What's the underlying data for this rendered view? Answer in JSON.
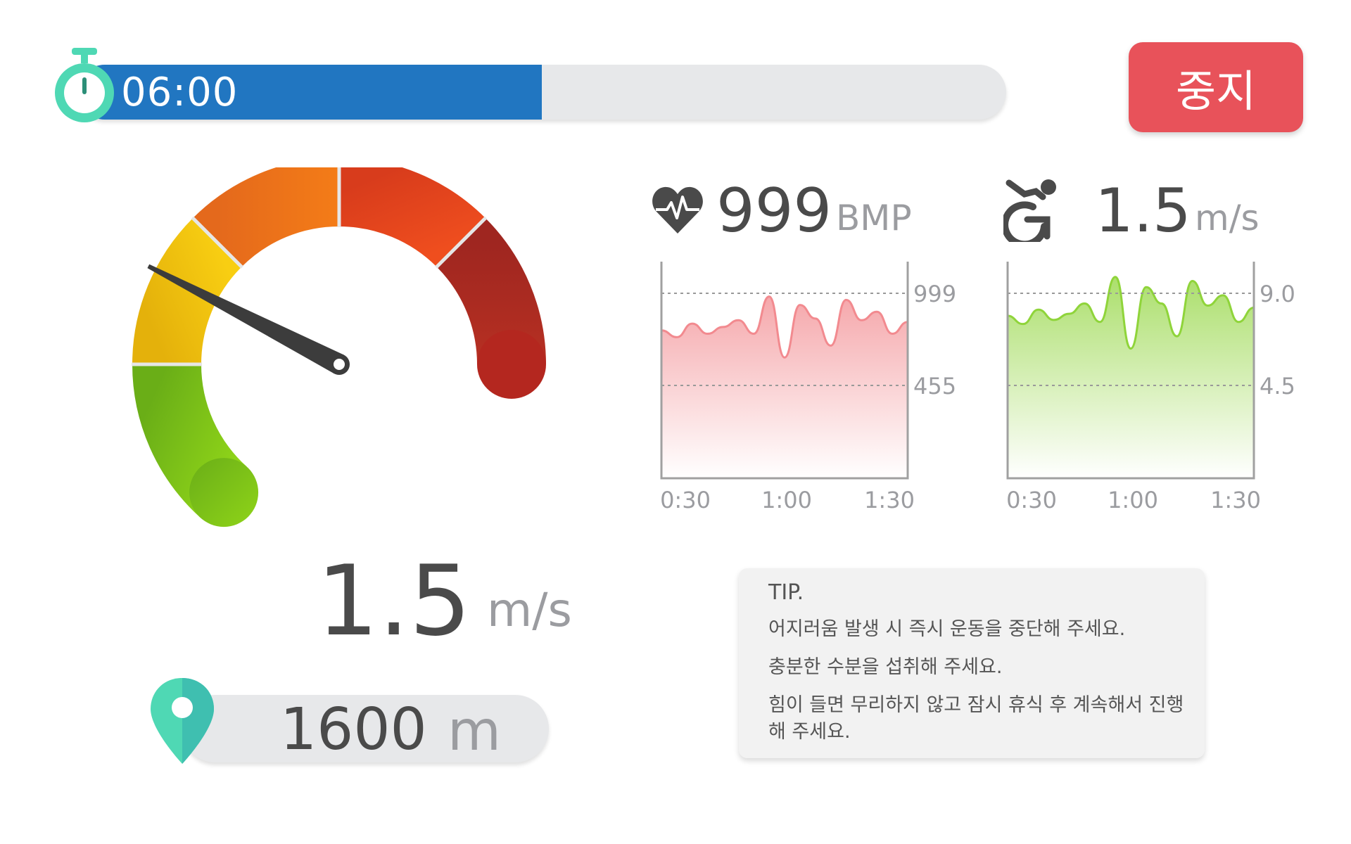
{
  "timer": {
    "label": "06:00",
    "progress": 0.5,
    "color": "#2176c1"
  },
  "stop_button": {
    "label": "중지",
    "color": "#e8525a"
  },
  "gauge": {
    "value": 1.5,
    "value_text": "1.5",
    "unit": "m/s",
    "needle_level": 0.33,
    "segment_colors": [
      "#7cc11a",
      "#f2c20e",
      "#ef7a1b",
      "#e94e1f",
      "#b4271f"
    ]
  },
  "distance": {
    "value": "1600",
    "unit": "m"
  },
  "heart_rate": {
    "icon": "heart-pulse-icon",
    "value": "999",
    "unit": "BMP",
    "color": "#f28a8f",
    "chart_data": {
      "type": "area",
      "x_ticks": [
        "0:30",
        "1:00",
        "1:30"
      ],
      "y_ticks": [
        "999",
        "455"
      ],
      "values": [
        780,
        740,
        820,
        760,
        800,
        840,
        760,
        980,
        620,
        930,
        850,
        690,
        960,
        840,
        890,
        760,
        830
      ]
    }
  },
  "speed": {
    "icon": "wheelchair-icon",
    "value": "1.5",
    "unit": "m/s",
    "color": "#8fd43a",
    "chart_data": {
      "type": "area",
      "x_ticks": [
        "0:30",
        "1:00",
        "1:30"
      ],
      "y_ticks": [
        "9.0",
        "4.5"
      ],
      "values": [
        7.9,
        7.5,
        8.2,
        7.7,
        8.0,
        8.5,
        7.6,
        9.8,
        6.3,
        9.3,
        8.5,
        6.9,
        9.6,
        8.4,
        8.9,
        7.6,
        8.3
      ]
    }
  },
  "tip": {
    "title": "TIP.",
    "lines": [
      "어지러움 발생 시 즉시 운동을 중단해 주세요.",
      "충분한 수분을 섭취해 주세요.",
      "힘이 들면 무리하지 않고 잠시 휴식 후 계속해서 진행해 주세요."
    ]
  }
}
